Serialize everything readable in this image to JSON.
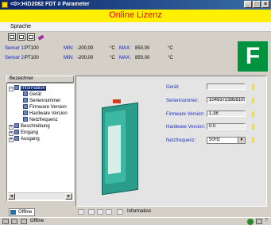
{
  "window": {
    "title": "<0>:HiD2082 FDT # Parameter",
    "minimize": "_",
    "maximize": "□",
    "close": "×"
  },
  "banner": {
    "text": "Online Lizenz"
  },
  "menu": {
    "items": [
      "Sprache"
    ]
  },
  "sensors": [
    {
      "label": "Sensor 1:",
      "type": "PT100",
      "min_label": "MIN:",
      "min": "-200,00",
      "unit1": "°C",
      "max_label": "MAX:",
      "max": "850,00",
      "unit2": "°C"
    },
    {
      "label": "Sensor 2:",
      "type": "PT100",
      "min_label": "MIN:",
      "min": "-200,00",
      "unit1": "°C",
      "max_label": "MAX:",
      "max": "850,00",
      "unit2": "°C"
    }
  ],
  "logo": {
    "glyph": "F"
  },
  "tree": {
    "header": "Bezeichner",
    "nodes": [
      {
        "label": "Information",
        "expander": "−",
        "selected": true
      },
      {
        "label": "Gerät"
      },
      {
        "label": "Seriennummer"
      },
      {
        "label": "Firmware Version"
      },
      {
        "label": "Hardware Version"
      },
      {
        "label": "Netzfrequenz"
      },
      {
        "label": "Beschreibung",
        "expander": "+"
      },
      {
        "label": "Eingang",
        "expander": "+"
      },
      {
        "label": "Ausgang",
        "expander": "+"
      }
    ]
  },
  "tabs": {
    "offline": "Offline"
  },
  "fields": {
    "geraet": {
      "label": "Gerät:",
      "value": ""
    },
    "seriennummer": {
      "label": "Seriennummer:",
      "value": "10493723858105"
    },
    "firmware": {
      "label": "Firmware Version:",
      "value": "1.38"
    },
    "hardware": {
      "label": "Hardware Version:",
      "value": "0.0"
    },
    "netzfrequenz": {
      "label": "Netzfrequenz:",
      "value": "50Hz"
    }
  },
  "main_toolbar": {
    "label": "Information"
  },
  "statusbar": {
    "text": "Offline",
    "help": "?"
  },
  "colors": {
    "banner": "#ffef00",
    "banner_text": "#e8001c",
    "logo": "#00923f",
    "device": "#2a9c8a"
  }
}
